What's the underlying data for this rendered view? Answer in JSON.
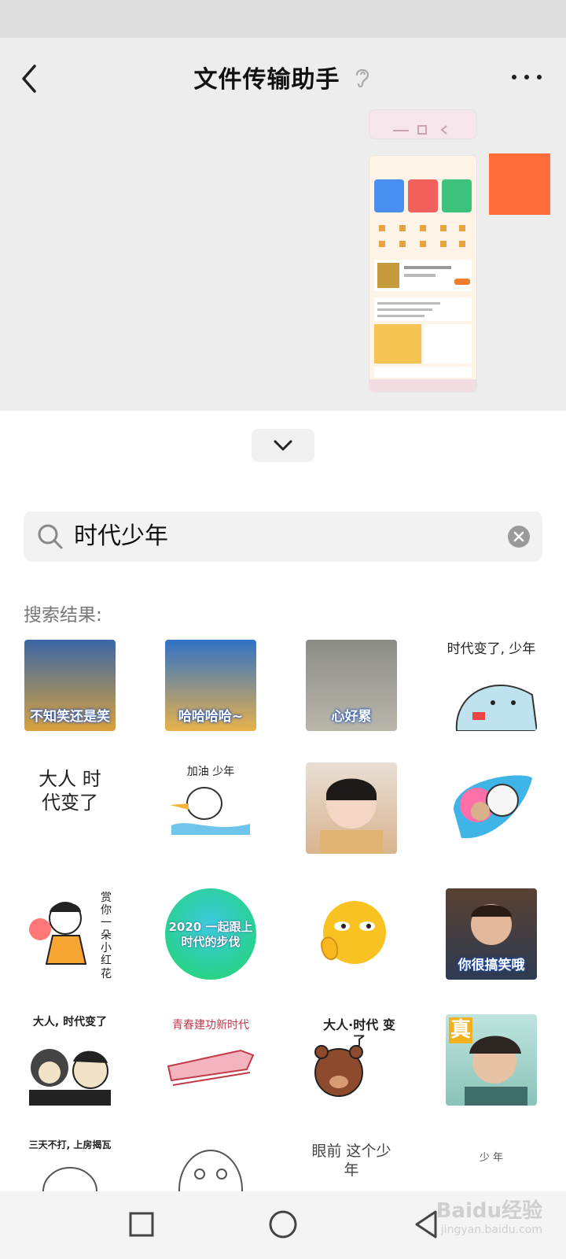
{
  "header": {
    "title": "文件传输助手",
    "back_icon": "chevron-left-icon",
    "ear_icon": "ear-icon",
    "more_icon": "more-horizontal-icon"
  },
  "chat": {
    "avatar_color": "#ff6e3a"
  },
  "search": {
    "value": "时代少年",
    "icon": "search-icon",
    "clear_icon": "clear-icon"
  },
  "results_label": "搜索结果:",
  "stickers": [
    {
      "caption": "不知笑还是笑"
    },
    {
      "caption": "哈哈哈哈~"
    },
    {
      "caption": "心好累"
    },
    {
      "caption": "时代变了, 少年"
    },
    {
      "caption": "大人 时代变了"
    },
    {
      "caption": "加油 少年"
    },
    {
      "caption": ""
    },
    {
      "caption": ""
    },
    {
      "caption": "赏你一朵小红花"
    },
    {
      "caption": "2020 一起跟上 时代的步伐"
    },
    {
      "caption": ""
    },
    {
      "caption": "你很搞笑哦"
    },
    {
      "caption": "大人, 时代变了"
    },
    {
      "caption": "青春建功新时代"
    },
    {
      "caption": "大人·时代 变了"
    },
    {
      "caption": "真"
    },
    {
      "caption": "三天不打, 上房揭瓦"
    },
    {
      "caption": ""
    },
    {
      "caption": "眼前 这个少年"
    },
    {
      "caption": "少 年"
    }
  ],
  "navbar": {
    "recent_icon": "square-icon",
    "home_icon": "circle-icon",
    "back_icon": "triangle-back-icon"
  },
  "watermark": {
    "text": "Baidu经验",
    "sub": "jingyan.baidu.com"
  }
}
